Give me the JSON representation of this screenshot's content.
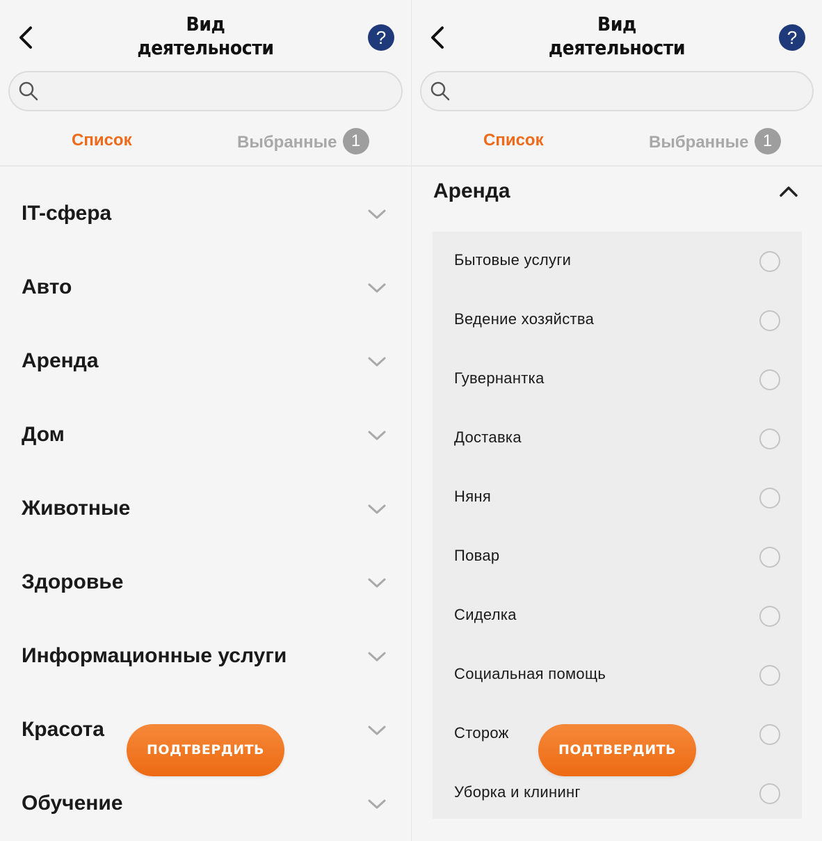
{
  "header": {
    "title_line1": "Вид",
    "title_line2": "деятельности",
    "help_label": "?"
  },
  "search": {
    "placeholder": ""
  },
  "tabs": {
    "list_label": "Список",
    "selected_label": "Выбранные",
    "selected_count": "1"
  },
  "categories": [
    "IT-сфера",
    "Авто",
    "Аренда",
    "Дом",
    "Животные",
    "Здоровье",
    "Информационные услуги",
    "Красота",
    "Обучение"
  ],
  "expanded_group": {
    "title": "Аренда",
    "items": [
      "Бытовые услуги",
      "Ведение хозяйства",
      "Гувернантка",
      "Доставка",
      "Няня",
      "Повар",
      "Сиделка",
      "Социальная помощь",
      "Сторож",
      "Уборка и клининг"
    ]
  },
  "confirm_label": "ПОДТВЕРДИТЬ",
  "colors": {
    "accent": "#ee6a1b",
    "help_circle": "#1f3a7a",
    "badge": "#9e9e9e"
  }
}
